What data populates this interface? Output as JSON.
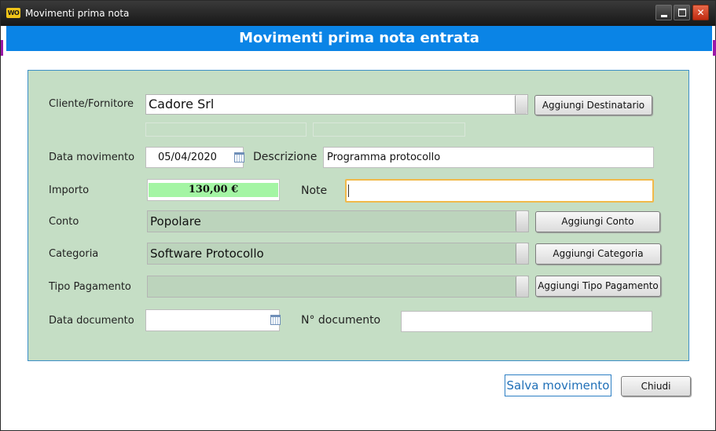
{
  "window": {
    "app_icon_text": "WO",
    "title": "Movimenti prima nota"
  },
  "header": {
    "title": "Movimenti prima nota entrata"
  },
  "form": {
    "cliente": {
      "label": "Cliente/Fornitore",
      "value": "Cadore Srl",
      "button": "Aggiungi Destinatario"
    },
    "data_movimento": {
      "label": "Data movimento",
      "value": "05/04/2020"
    },
    "descrizione": {
      "label": "Descrizione",
      "value": "Programma protocollo"
    },
    "importo": {
      "label": "Importo",
      "value": "130,00 €",
      "highlight_color": "#a4f5a4"
    },
    "note": {
      "label": "Note",
      "value": ""
    },
    "conto": {
      "label": "Conto",
      "value": "Popolare",
      "button": "Aggiungi Conto"
    },
    "categoria": {
      "label": "Categoria",
      "value": "Software Protocollo",
      "button": "Aggiungi Categoria"
    },
    "tipo_pagamento": {
      "label": "Tipo Pagamento",
      "value": "",
      "button": "Aggiungi Tipo Pagamento"
    },
    "data_documento": {
      "label": "Data documento",
      "value": ""
    },
    "n_documento": {
      "label": "N° documento",
      "value": ""
    }
  },
  "footer": {
    "save_label": "Salva movimento",
    "close_label": "Chiudi"
  },
  "colors": {
    "header_bg": "#0a84e6",
    "panel_bg": "#c5dec5",
    "note_focus_border": "#f1b94a",
    "save_text": "#1f6fb7"
  },
  "icons": [
    "app-logo-icon",
    "minimize-icon",
    "maximize-icon",
    "close-icon",
    "calendar-icon",
    "dropdown-arrow-icon"
  ]
}
